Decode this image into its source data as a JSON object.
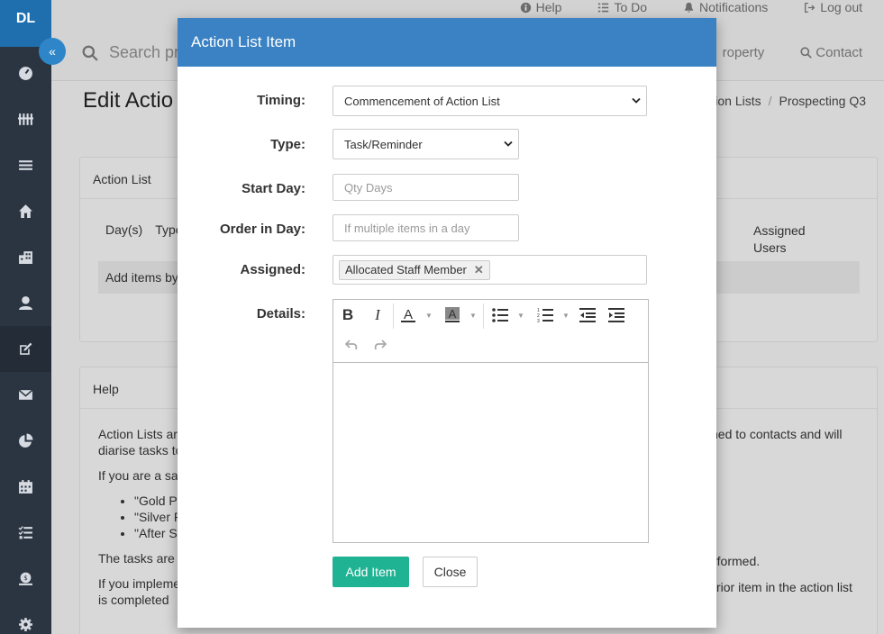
{
  "sidebar": {
    "logo": "DL",
    "icons": [
      "dashboard-icon",
      "bar-chart-icon",
      "menu-icon",
      "home-icon",
      "building-icon",
      "user-icon",
      "edit-icon",
      "envelope-icon",
      "pie-chart-icon",
      "calendar-icon",
      "task-list-icon",
      "money-icon",
      "gear-icon"
    ]
  },
  "topbar": {
    "help": "Help",
    "todo": "To Do",
    "notifications": "Notifications",
    "logout": "Log out",
    "search_placeholder": "Search pr",
    "nav_property": "roperty",
    "nav_contact": "Contact"
  },
  "page": {
    "title": "Edit Actio",
    "breadcrumb": [
      "tion Lists",
      "Prospecting Q3"
    ]
  },
  "action_list_panel": {
    "title": "Action List",
    "columns": [
      "Day(s)",
      "Type"
    ],
    "assigned_users": "Assigned Users",
    "empty_text": "Add items by"
  },
  "help_panel": {
    "title": "Help",
    "p1": "Action Lists are",
    "p1_right": "ned to contacts and will",
    "p1b": "diarise tasks to",
    "p2": "If you are a sal",
    "bullets": [
      "\"Gold Pr",
      "\"Silver P",
      "\"After Sa"
    ],
    "p3": "The tasks are s",
    "p3_right": "rformed.",
    "p4": "If you impleme",
    "p4_right": "rior item in the action list",
    "p4b": "is completed"
  },
  "modal": {
    "title": "Action List Item",
    "timing_label": "Timing:",
    "timing_value": "Commencement of Action List",
    "type_label": "Type:",
    "type_value": "Task/Reminder",
    "start_day_label": "Start Day:",
    "start_day_placeholder": "Qty Days",
    "order_label": "Order in Day:",
    "order_placeholder": "If multiple items in a day",
    "assigned_label": "Assigned:",
    "assigned_tag": "Allocated Staff Member",
    "details_label": "Details:",
    "add_button": "Add Item",
    "close_button": "Close"
  }
}
